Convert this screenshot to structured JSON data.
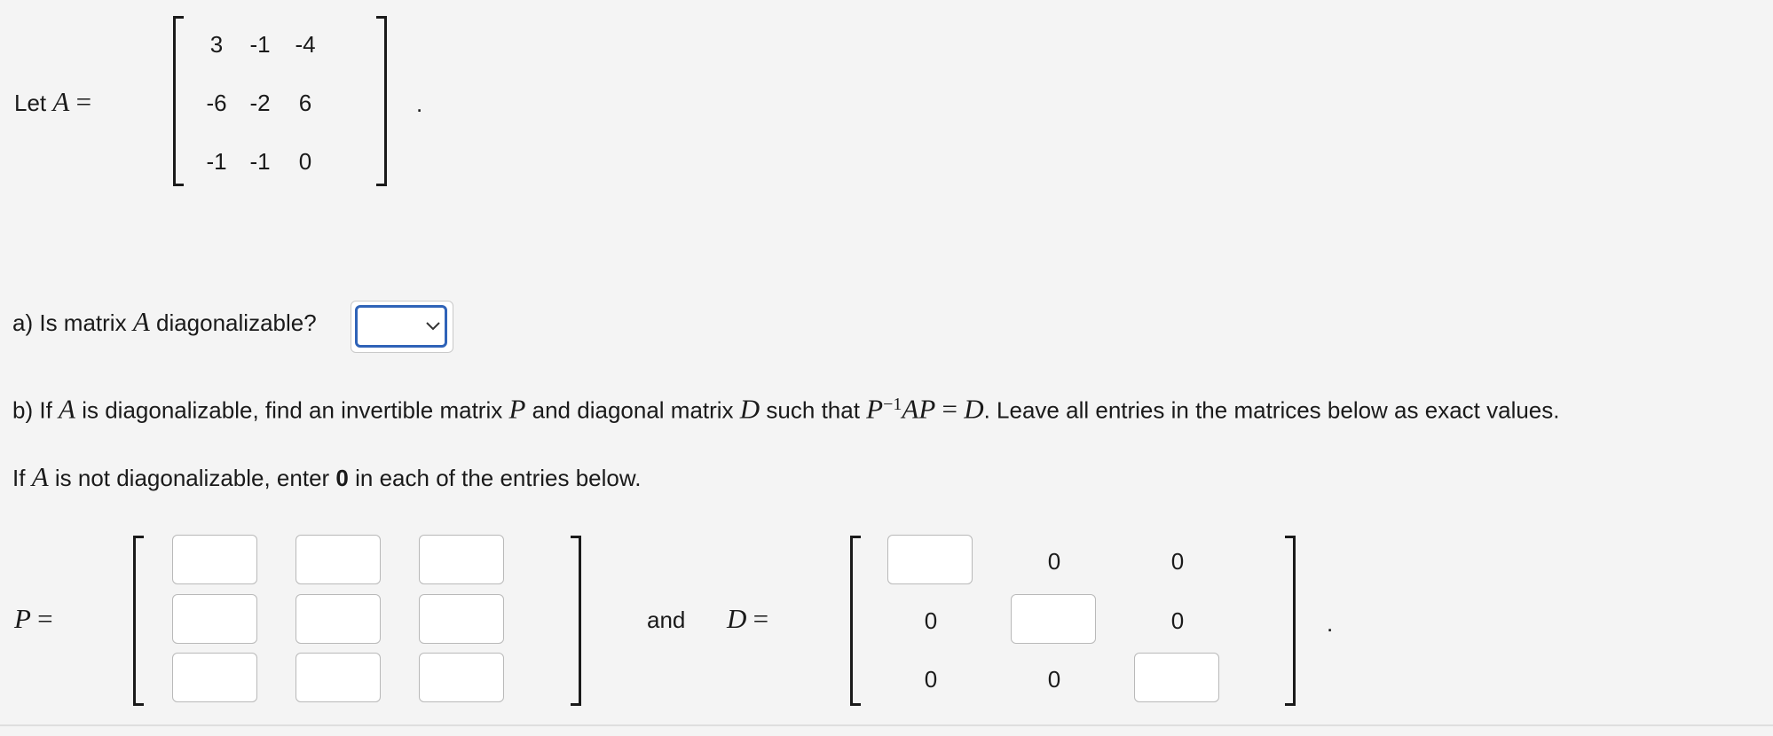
{
  "intro": {
    "let_label": "Let",
    "var": "A",
    "eq": "=",
    "period": "."
  },
  "matrix_A": [
    [
      "3",
      "-1",
      "-4"
    ],
    [
      "-6",
      "-2",
      "6"
    ],
    [
      "-1",
      "-1",
      "0"
    ]
  ],
  "part_a": {
    "prefix": "a) Is matrix",
    "var": "A",
    "suffix": "diagonalizable?",
    "dropdown_value": ""
  },
  "part_b": {
    "t1": "b) If",
    "v1": "A",
    "t2": "is diagonalizable, find an invertible matrix",
    "v2": "P",
    "t3": "and diagonal matrix",
    "v3": "D",
    "t4": "such that",
    "eq_P": "P",
    "eq_exp": "−1",
    "eq_AP": "AP",
    "eq_sign": "=",
    "eq_D": "D",
    "t5": ". Leave all entries in the matrices below as exact values."
  },
  "note": {
    "t1": "If",
    "v1": "A",
    "t2": "is not diagonalizable, enter",
    "bold": "0",
    "t3": "in each of the entries below."
  },
  "matrix_P": {
    "label": "P",
    "eq": "=",
    "entries": [
      [
        "",
        "",
        ""
      ],
      [
        "",
        "",
        ""
      ],
      [
        "",
        "",
        ""
      ]
    ]
  },
  "and_label": "and",
  "matrix_D": {
    "label": "D",
    "eq": "=",
    "fixed": {
      "r0c1": "0",
      "r0c2": "0",
      "r1c0": "0",
      "r1c2": "0",
      "r2c0": "0",
      "r2c1": "0"
    },
    "diag": [
      "",
      "",
      ""
    ],
    "period": "."
  }
}
